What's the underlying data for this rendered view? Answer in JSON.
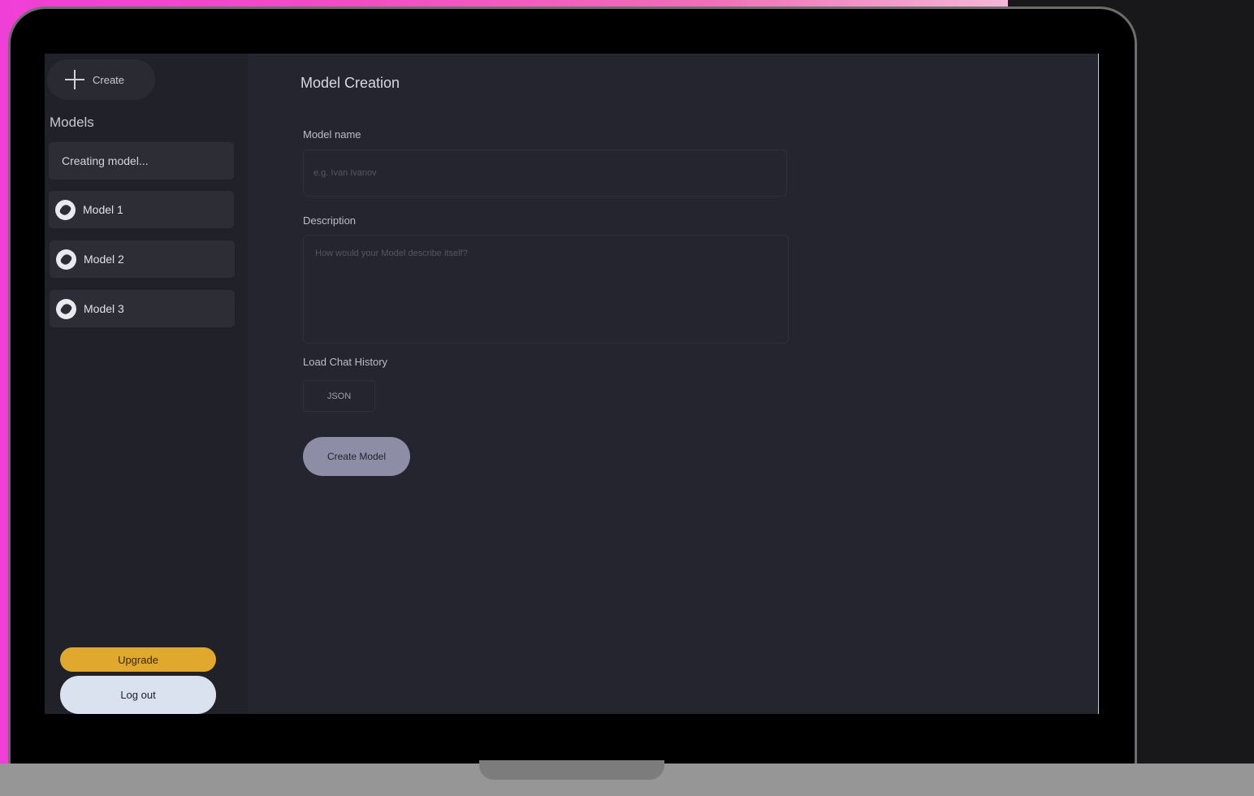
{
  "sidebar": {
    "create_label": "Create",
    "models_heading": "Models",
    "creating_label": "Creating model...",
    "models": [
      {
        "label": "Model 1"
      },
      {
        "label": "Model 2"
      },
      {
        "label": "Model 3"
      }
    ],
    "upgrade_label": "Upgrade",
    "logout_label": "Log out"
  },
  "main": {
    "title": "Model Creation",
    "model_name": {
      "label": "Model name",
      "placeholder": "e.g. Ivan Ivanov",
      "value": ""
    },
    "description": {
      "label": "Description",
      "placeholder": "How would your Model describe itself?",
      "value": ""
    },
    "chat_history": {
      "label": "Load Chat History",
      "button_label": "JSON"
    },
    "submit_label": "Create Model"
  },
  "colors": {
    "upgrade": "#e0a82c",
    "logout": "#dbe2ef",
    "submit": "#8d8da6",
    "sidebar_bg": "#212129",
    "main_bg": "#25252f"
  },
  "icons": {
    "create": "plus-icon",
    "model": "model-avatar-icon"
  }
}
